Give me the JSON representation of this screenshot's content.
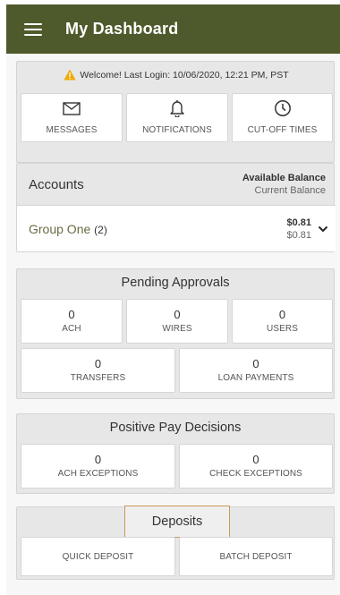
{
  "header": {
    "title": "My Dashboard",
    "menu_icon": "hamburger-icon",
    "bar_color": "#4f5a2c"
  },
  "welcome": {
    "text": "Welcome! Last Login: 10/06/2020, 12:21 PM, PST",
    "icon": "warning-icon"
  },
  "quick_links": [
    {
      "label": "MESSAGES",
      "icon": "envelope-icon"
    },
    {
      "label": "NOTIFICATIONS",
      "icon": "bell-icon"
    },
    {
      "label": "CUT-OFF TIMES",
      "icon": "clock-icon"
    }
  ],
  "accounts": {
    "title": "Accounts",
    "available_label": "Available Balance",
    "current_label": "Current Balance",
    "groups": [
      {
        "name": "Group One",
        "count": "(2)",
        "available": "$0.81",
        "current": "$0.81"
      }
    ]
  },
  "pending_approvals": {
    "title": "Pending Approvals",
    "items": [
      {
        "count": "0",
        "label": "ACH"
      },
      {
        "count": "0",
        "label": "WIRES"
      },
      {
        "count": "0",
        "label": "USERS"
      },
      {
        "count": "0",
        "label": "TRANSFERS"
      },
      {
        "count": "0",
        "label": "LOAN PAYMENTS"
      }
    ]
  },
  "positive_pay": {
    "title": "Positive Pay Decisions",
    "items": [
      {
        "count": "0",
        "label": "ACH EXCEPTIONS"
      },
      {
        "count": "0",
        "label": "CHECK EXCEPTIONS"
      }
    ]
  },
  "deposits": {
    "title": "Deposits",
    "items": [
      {
        "label": "QUICK DEPOSIT"
      },
      {
        "label": "BATCH DEPOSIT"
      }
    ]
  },
  "colors": {
    "accent": "#4f5a2c",
    "highlight_border": "#c89a58",
    "warning": "#f2a900",
    "group_link": "#6b6b43"
  }
}
